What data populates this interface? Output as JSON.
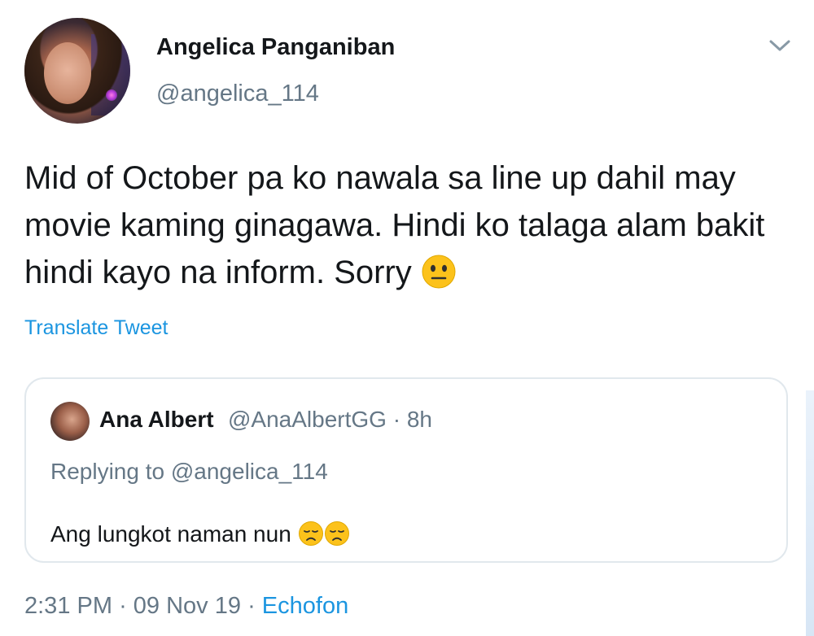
{
  "tweet": {
    "author": {
      "display_name": "Angelica Panganiban",
      "handle": "@angelica_114",
      "avatar_icon": "profile-photo"
    },
    "text": "Mid of October pa ko nawala sa line up dahil may movie kaming ginagawa. Hindi ko talaga alam bakit hindi kayo na inform. Sorry",
    "text_emoji": "neutral-face-emoji",
    "translate_label": "Translate Tweet",
    "menu_icon": "chevron-down-icon",
    "timestamp": "2:31 PM",
    "date": "09 Nov 19",
    "separator": "·",
    "source": "Echofon"
  },
  "quoted": {
    "author": {
      "display_name": "Ana Albert",
      "handle": "@AnaAlbertGG · 8h",
      "avatar_icon": "profile-photo"
    },
    "replying_to": "Replying to @angelica_114",
    "text": "Ang lungkot naman nun",
    "text_emojis": [
      "disappointed-face-emoji",
      "disappointed-face-emoji"
    ]
  },
  "colors": {
    "text": "#14171a",
    "secondary": "#657786",
    "link": "#1b95e0",
    "border": "#e1e8ed",
    "emoji_yellow": "#fcc21b"
  }
}
